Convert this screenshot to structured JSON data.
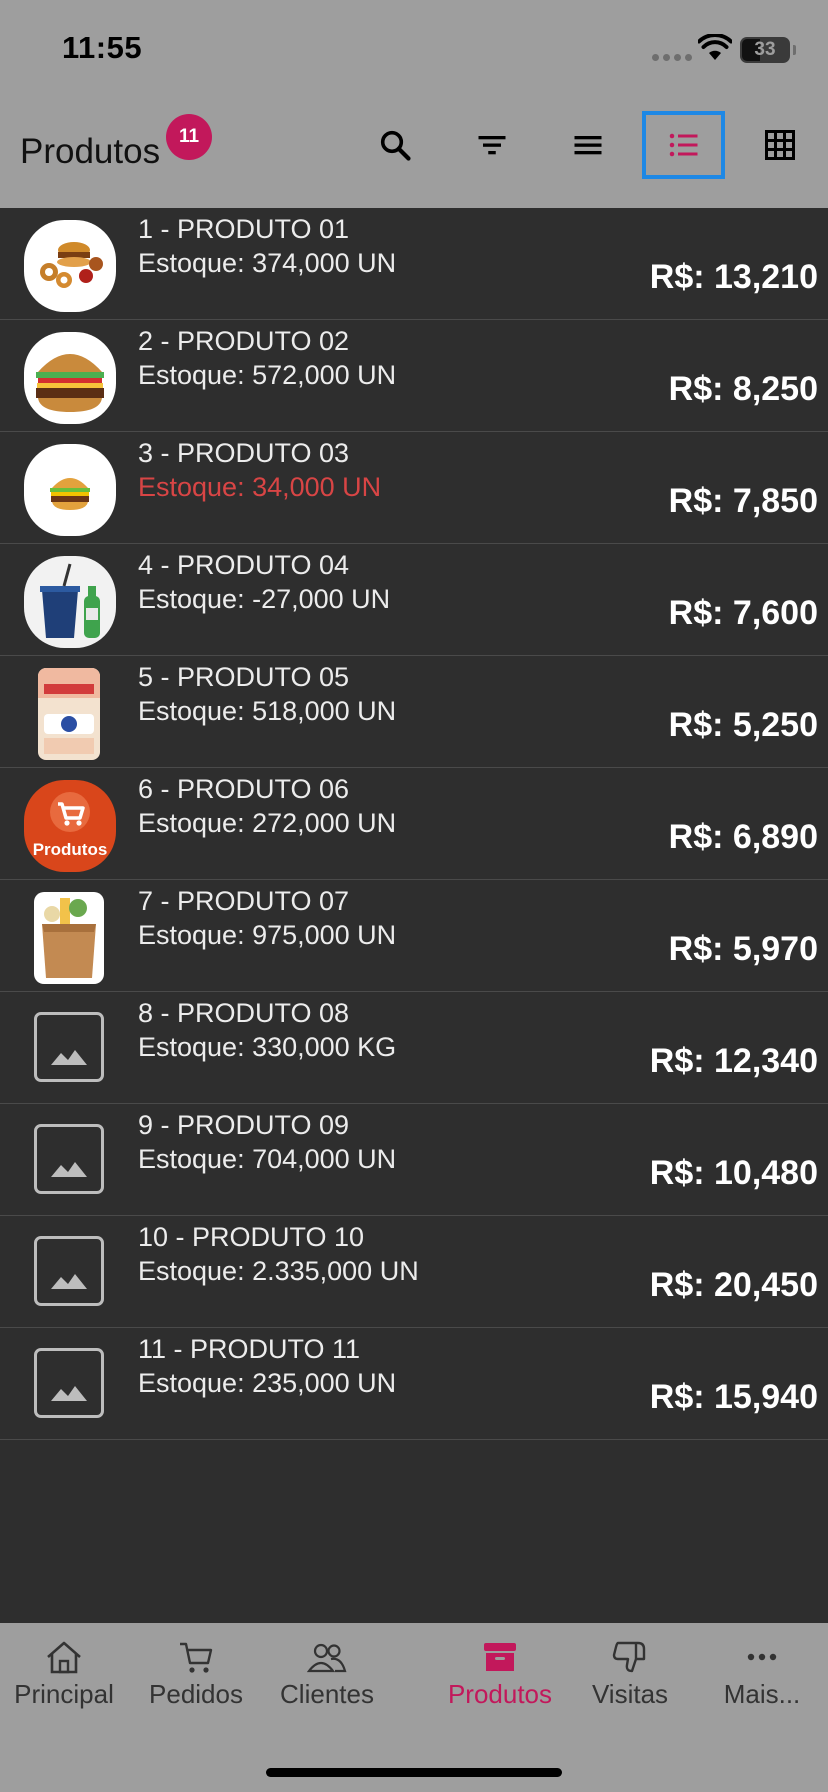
{
  "status_bar": {
    "time": "11:55",
    "battery": "33"
  },
  "header": {
    "title": "Produtos",
    "badge_count": "11",
    "buttons": [
      {
        "name": "search-button",
        "icon": "search-icon"
      },
      {
        "name": "filter-button",
        "icon": "filter-icon"
      },
      {
        "name": "menu-button",
        "icon": "menu-icon"
      },
      {
        "name": "list-view-button",
        "icon": "list-icon",
        "selected": true
      },
      {
        "name": "grid-view-button",
        "icon": "grid-icon"
      }
    ]
  },
  "products": [
    {
      "title": "1 - PRODUTO 01",
      "stock": "Estoque: 374,000 UN",
      "price": "R$: 13,210",
      "thumb": "combo-meal"
    },
    {
      "title": "2 - PRODUTO 02",
      "stock": "Estoque: 572,000 UN",
      "price": "R$: 8,250",
      "thumb": "burger"
    },
    {
      "title": "3 - PRODUTO 03",
      "stock": "Estoque: 34,000 UN",
      "price": "R$: 7,850",
      "thumb": "small-burger",
      "low_stock": true
    },
    {
      "title": "4 - PRODUTO 04",
      "stock": "Estoque: -27,000 UN",
      "price": "R$: 7,600",
      "thumb": "drinks"
    },
    {
      "title": "5 - PRODUTO 05",
      "stock": "Estoque: 518,000 UN",
      "price": "R$: 5,250",
      "thumb": "paper-towels"
    },
    {
      "title": "6 - PRODUTO 06",
      "stock": "Estoque: 272,000 UN",
      "price": "R$: 6,890",
      "thumb": "produtos-logo",
      "logo_text": "Produtos"
    },
    {
      "title": "7 - PRODUTO 07",
      "stock": "Estoque: 975,000 UN",
      "price": "R$: 5,970",
      "thumb": "grocery-bag"
    },
    {
      "title": "8 - PRODUTO 08",
      "stock": "Estoque: 330,000 KG",
      "price": "R$: 12,340",
      "thumb": "placeholder"
    },
    {
      "title": "9 - PRODUTO 09",
      "stock": "Estoque: 704,000 UN",
      "price": "R$: 10,480",
      "thumb": "placeholder"
    },
    {
      "title": "10 - PRODUTO 10",
      "stock": "Estoque: 2.335,000 UN",
      "price": "R$: 20,450",
      "thumb": "placeholder"
    },
    {
      "title": "11 - PRODUTO 11",
      "stock": "Estoque: 235,000 UN",
      "price": "R$: 15,940",
      "thumb": "placeholder"
    }
  ],
  "bottom_nav": [
    {
      "label": "Principal",
      "icon": "home-icon"
    },
    {
      "label": "Pedidos",
      "icon": "cart-icon"
    },
    {
      "label": "Clientes",
      "icon": "users-icon"
    },
    {
      "label": "Produtos",
      "icon": "box-icon",
      "active": true
    },
    {
      "label": "Visitas",
      "icon": "thumbs-down-icon"
    },
    {
      "label": "Mais...",
      "icon": "more-icon"
    }
  ],
  "colors": {
    "accent": "#c2185b",
    "selection": "#1e88e5",
    "low_stock": "#d84545",
    "list_background": "#2e2e2e",
    "bars": "#9e9e9e"
  }
}
